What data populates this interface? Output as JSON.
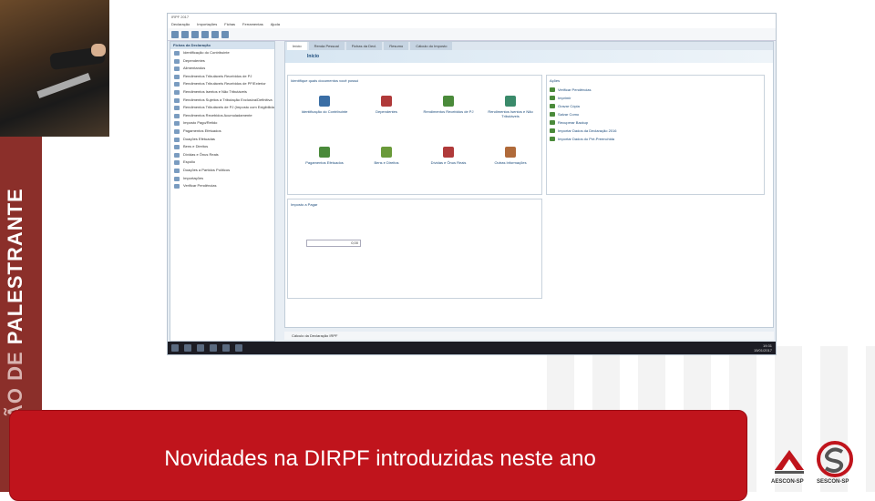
{
  "slide": {
    "vertical_text_light": "ÃO DE ",
    "vertical_text_bold": "PALESTRANTE",
    "caption": "Novidades na DIRPF introduzidas neste ano"
  },
  "logos": {
    "aescon_label": "AESCON-SP",
    "sescon_label": "SESCON-SP"
  },
  "app": {
    "title": "IRPF 2017",
    "menu": [
      "Declaração",
      "Importações",
      "Fichas",
      "Ferramentas",
      "Ajuda"
    ],
    "tabs": [
      "Início",
      "Renda Pessoal",
      "Fichas da Decl.",
      "Resumo",
      "Cálculo do Imposto"
    ],
    "banner": "Início",
    "nav_header": "Fichas da Declaração",
    "nav_items": [
      "Identificação do Contribuinte",
      "Dependentes",
      "Alimentandos",
      "Rendimentos Tributáveis Recebidos de PJ",
      "Rendimentos Tributáveis Recebidos de PF/Exterior",
      "Rendimentos Isentos e Não Tributáveis",
      "Rendimentos Sujeitos à Tributação Exclusiva/Definitiva",
      "Rendimentos Tributáveis de PJ (Imposto com Exigibilidade Suspensa)",
      "Rendimentos Recebidos Acumuladamente",
      "Imposto Pago/Retido",
      "Pagamentos Efetuados",
      "Doações Efetuadas",
      "Bens e Direitos",
      "Dívidas e Ônus Reais",
      "Espólio",
      "Doações a Partidos Políticos",
      "Importações",
      "Verificar Pendências"
    ],
    "main_title": "Identifique quais documentos você possui",
    "main_items": [
      "Identificação do Contribuinte",
      "Dependentes",
      "Rendimentos Recebidos de PJ",
      "Rendimentos Isentos e Não Tributáveis",
      "Pagamentos Efetuados",
      "Bens e Direitos",
      "Dívidas e Ônus Reais",
      "Outras Informações"
    ],
    "actions_title": "Ações",
    "actions": [
      "Verificar Pendências",
      "Imprimir",
      "Gravar Cópia",
      "Salvar Como",
      "Recuperar Backup",
      "Importar Dados da Declaração 2016",
      "Importar Dados do Pré-Preenchida"
    ],
    "tax_title": "Imposto a Pagar",
    "tax_value": "0,00",
    "status": "Cálculo da Declaração IRPF",
    "clock_time": "19:31",
    "clock_date": "15/01/2017"
  },
  "colors": {
    "band": "#8b2f2a",
    "caption_bg": "#c0141c",
    "caption_text": "#ffffff"
  }
}
